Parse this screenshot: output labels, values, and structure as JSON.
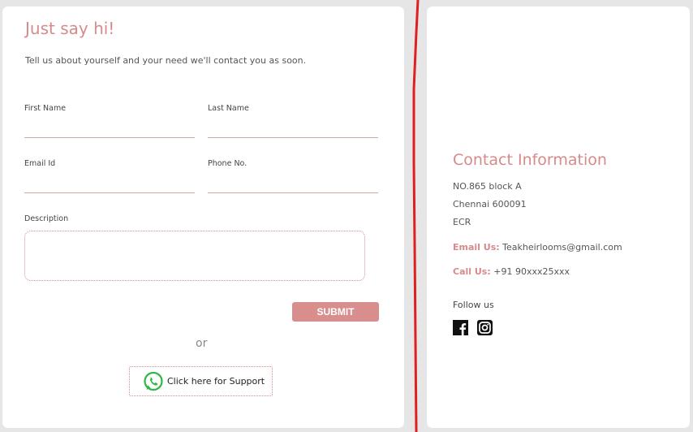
{
  "form": {
    "title": "Just say hi!",
    "subtitle": "Tell us about yourself and your need we'll contact you as soon.",
    "first_name_label": "First Name",
    "last_name_label": "Last Name",
    "email_label": "Email Id",
    "phone_label": "Phone No.",
    "description_label": "Description",
    "submit_label": "SUBMIT",
    "or_text": "or",
    "support_label": "Click here for Support"
  },
  "contact": {
    "title": "Contact Information",
    "address_line1": "NO.865 block A",
    "address_line2": "Chennai 600091",
    "address_line3": "ECR",
    "email_key": "Email Us:",
    "email_value": "Teakheirlooms@gmail.com",
    "call_key": "Call Us:",
    "call_value": "+91 90xxx25xxx",
    "follow_label": "Follow us"
  },
  "icons": {
    "whatsapp": "whatsapp-icon",
    "facebook": "facebook-icon",
    "instagram": "instagram-icon"
  },
  "colors": {
    "accent": "#d58b8b",
    "button": "#d98e8e",
    "whatsapp": "#2fb845",
    "divider": "#e02020"
  }
}
